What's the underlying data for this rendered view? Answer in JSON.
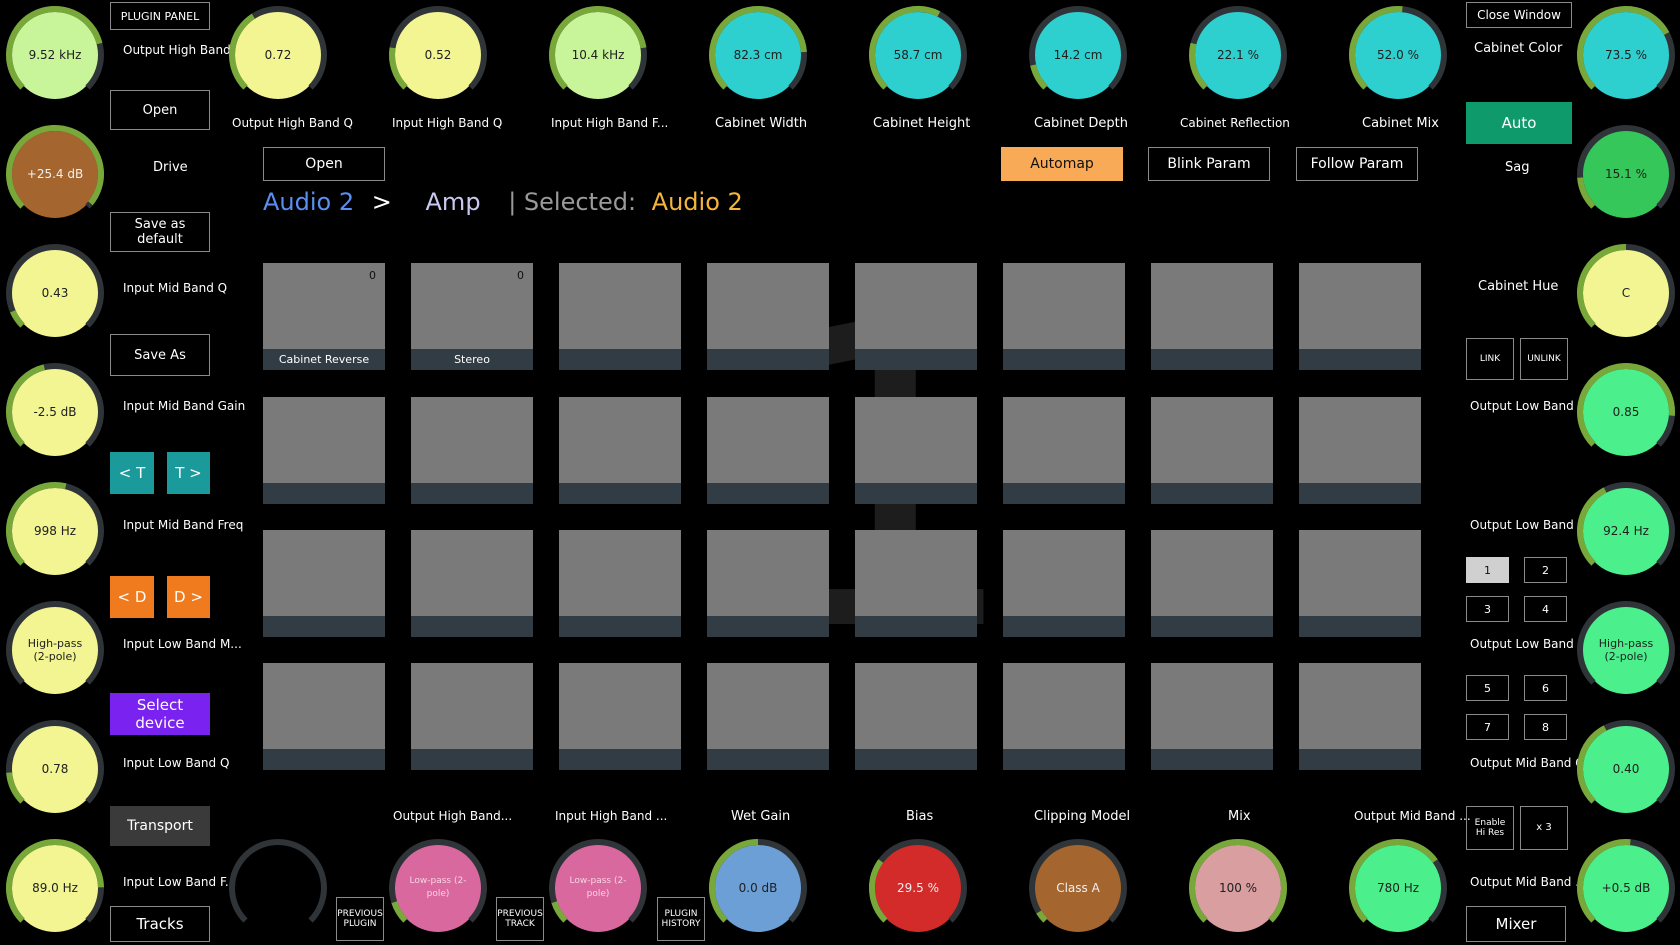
{
  "colors": {
    "background": "#000000",
    "pad": "#7a7a7a",
    "pad_strip": "#323c44",
    "teal_button": "#1a9a9a",
    "orange_button": "#f07b1e",
    "purple_button": "#7a22f0",
    "auto_button": "#0f9a6b",
    "automap_button": "#f8aa56"
  },
  "knobs": [
    {
      "id": "left-1",
      "value": "9.52 kHz",
      "fill": "#c9f59a",
      "level": 0.78
    },
    {
      "id": "left-2",
      "value": "+25.4 dB",
      "fill": "#a4652e",
      "level": 0.98,
      "light": true
    },
    {
      "id": "left-3",
      "value": "0.43",
      "fill": "#f2f592",
      "level": 0.08
    },
    {
      "id": "left-4",
      "value": "-2.5 dB",
      "fill": "#f2f592",
      "level": 0.45
    },
    {
      "id": "left-5",
      "value": "998 Hz",
      "fill": "#f2f592",
      "level": 0.55
    },
    {
      "id": "left-6",
      "value": "High-pass (2-pole)",
      "fill": "#f2f592",
      "level": 0.0
    },
    {
      "id": "left-7",
      "value": "0.78",
      "fill": "#f2f592",
      "level": 0.15
    },
    {
      "id": "left-8",
      "value": "89.0 Hz",
      "fill": "#f2f592",
      "level": 0.83
    },
    {
      "id": "top-1",
      "value": "0.72",
      "fill": "#f2f592",
      "level": 0.38
    },
    {
      "id": "top-2",
      "value": "0.52",
      "fill": "#f2f592",
      "level": 0.2
    },
    {
      "id": "top-3",
      "value": "10.4 kHz",
      "fill": "#c9f59a",
      "level": 0.8
    },
    {
      "id": "top-4",
      "value": "82.3 cm",
      "fill": "#2ed0cf",
      "level": 0.82
    },
    {
      "id": "top-5",
      "value": "58.7 cm",
      "fill": "#2ed0cf",
      "level": 0.6
    },
    {
      "id": "top-6",
      "value": "14.2 cm",
      "fill": "#2ed0cf",
      "level": 0.12
    },
    {
      "id": "top-7",
      "value": "22.1 %",
      "fill": "#2ed0cf",
      "level": 0.22
    },
    {
      "id": "top-8",
      "value": "52.0 %",
      "fill": "#2ed0cf",
      "level": 0.52
    },
    {
      "id": "right-1",
      "value": "73.5 %",
      "fill": "#2ed0cf",
      "level": 0.73
    },
    {
      "id": "right-2",
      "value": "15.1 %",
      "fill": "#36c75a",
      "level": 0.15
    },
    {
      "id": "right-3",
      "value": "C",
      "fill": "#f2f592",
      "level": 0.5
    },
    {
      "id": "right-4",
      "value": "0.85",
      "fill": "#4bf08c",
      "level": 0.85
    },
    {
      "id": "right-5",
      "value": "92.4 Hz",
      "fill": "#4bf08c",
      "level": 0.4
    },
    {
      "id": "right-6",
      "value": "High-pass (2-pole)",
      "fill": "#4bf08c",
      "level": 0.0
    },
    {
      "id": "right-7",
      "value": "0.40",
      "fill": "#4bf08c",
      "level": 0.4
    },
    {
      "id": "right-8",
      "value": "+0.5 dB",
      "fill": "#4bf08c",
      "level": 0.52
    },
    {
      "id": "bottom-0",
      "value": "",
      "fill": "#000000",
      "level": 0.0
    },
    {
      "id": "bottom-1",
      "value": "Low-pass (2-pole)",
      "fill": "#d9689e",
      "level": 0.1
    },
    {
      "id": "bottom-2",
      "value": "Low-pass (2-pole)",
      "fill": "#d9689e",
      "level": 0.1
    },
    {
      "id": "bottom-3",
      "value": "0.0 dB",
      "fill": "#6c9fd6",
      "level": 0.5
    },
    {
      "id": "bottom-4",
      "value": "29.5 %",
      "fill": "#d32a2a",
      "level": 0.3,
      "light": true
    },
    {
      "id": "bottom-5",
      "value": "Class A",
      "fill": "#a4652e",
      "level": 0.05,
      "light": true
    },
    {
      "id": "bottom-6",
      "value": "100 %",
      "fill": "#d89ea0",
      "level": 1.0
    },
    {
      "id": "bottom-7",
      "value": "780 Hz",
      "fill": "#4bf08c",
      "level": 0.7
    },
    {
      "id": "bottom-8",
      "value": "",
      "fill": "#000000",
      "level": 0.0
    }
  ],
  "labels": {
    "left": [
      "Output High Band...",
      "Drive",
      "Input Mid Band Q",
      "Input Mid Band Gain",
      "Input Mid Band Freq",
      "Input Low Band M...",
      "Input Low Band Q",
      "Input Low Band F..."
    ],
    "top": [
      "Output High Band Q",
      "Input High Band Q",
      "Input High Band F...",
      "Cabinet Width",
      "Cabinet Height",
      "Cabinet Depth",
      "Cabinet Reflection",
      "Cabinet Mix"
    ],
    "right": [
      "Cabinet Color",
      "Sag",
      "Cabinet Hue",
      "Output Low Band Q",
      "Output Low Band ...",
      "Output Low Band ...",
      "Output Mid Band Q",
      "Output Mid Band ..."
    ],
    "bottom": [
      "Output High Band...",
      "Input High Band ...",
      "Wet Gain",
      "Bias",
      "Clipping Model",
      "Mix",
      "Output Mid Band ..."
    ]
  },
  "left_buttons": {
    "plugin_panel": "PLUGIN PANEL",
    "open": "Open",
    "save_default": "Save as default",
    "save_as": "Save As",
    "track_prev": "< T",
    "track_next": "T >",
    "device_prev": "< D",
    "device_next": "D >",
    "select_device": "Select device",
    "transport": "Transport",
    "tracks": "Tracks"
  },
  "bottom_buttons": {
    "previous_plugin": "PREVIOUS PLUGIN",
    "previous_track": "PREVIOUS TRACK",
    "plugin_history": "PLUGIN HISTORY"
  },
  "right_buttons": {
    "close_window": "Close Window",
    "auto": "Auto",
    "link": "LINK",
    "unlink": "UNLINK",
    "banks": [
      "1",
      "2",
      "3",
      "4",
      "5",
      "6",
      "7",
      "8"
    ],
    "enable_hi_res": "Enable Hi Res",
    "x3": "x 3",
    "mixer": "Mixer"
  },
  "toolbar": {
    "open": "Open",
    "automap": "Automap",
    "blink_param": "Blink Param",
    "follow_param": "Follow Param"
  },
  "breadcrumb": {
    "track": "Audio 2",
    "sep": ">",
    "device": "Amp",
    "selected_prefix": "| Selected:",
    "selected_value": "Audio 2"
  },
  "page_number": "1",
  "pads": [
    {
      "label": "Cabinet Reverse",
      "value": "0"
    },
    {
      "label": "Stereo",
      "value": "0"
    },
    {
      "label": "",
      "value": ""
    },
    {
      "label": "",
      "value": ""
    },
    {
      "label": "",
      "value": ""
    },
    {
      "label": "",
      "value": ""
    },
    {
      "label": "",
      "value": ""
    },
    {
      "label": "",
      "value": ""
    },
    {
      "label": "",
      "value": ""
    },
    {
      "label": "",
      "value": ""
    },
    {
      "label": "",
      "value": ""
    },
    {
      "label": "",
      "value": ""
    },
    {
      "label": "",
      "value": ""
    },
    {
      "label": "",
      "value": ""
    },
    {
      "label": "",
      "value": ""
    },
    {
      "label": "",
      "value": ""
    },
    {
      "label": "",
      "value": ""
    },
    {
      "label": "",
      "value": ""
    },
    {
      "label": "",
      "value": ""
    },
    {
      "label": "",
      "value": ""
    },
    {
      "label": "",
      "value": ""
    },
    {
      "label": "",
      "value": ""
    },
    {
      "label": "",
      "value": ""
    },
    {
      "label": "",
      "value": ""
    },
    {
      "label": "",
      "value": ""
    },
    {
      "label": "",
      "value": ""
    },
    {
      "label": "",
      "value": ""
    },
    {
      "label": "",
      "value": ""
    },
    {
      "label": "",
      "value": ""
    },
    {
      "label": "",
      "value": ""
    },
    {
      "label": "",
      "value": ""
    },
    {
      "label": "",
      "value": ""
    }
  ]
}
